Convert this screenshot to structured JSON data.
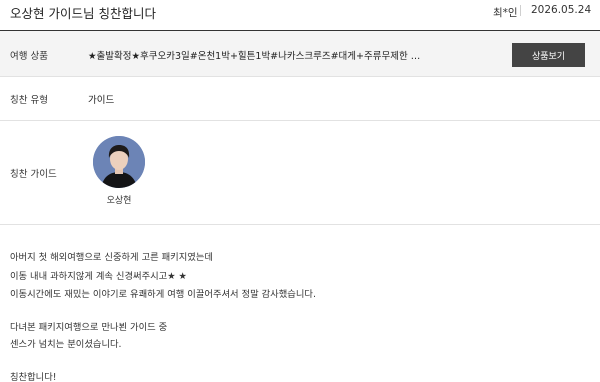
{
  "header": {
    "title": "오상현 가이드님 칭찬합니다",
    "author": "최*인",
    "date": "2026.05.24"
  },
  "info": {
    "product_label": "여행 상품",
    "product_value": "★출발확정★후쿠오카3일#온천1박+힐튼1박#나카스크루즈#대게+주류무제한 #유...",
    "product_button": "상품보기",
    "type_label": "칭찬 유형",
    "type_value": "가이드",
    "guide_label": "칭찬 가이드",
    "guide_name": "오상현"
  },
  "body": {
    "lines": [
      "아버지 첫 해외여행으로 신중하게 고른 패키지였는데",
      "이동 내내 과하지않게 계속 신경써주시고★ ★",
      "이동시간에도 재밌는 이야기로 유쾌하게 여행 이끌어주셔서 정말 감사했습니다.",
      "",
      "다녀본 패키지여행으로 만나뵌 가이드 중",
      "센스가 넘치는 분이셨습니다.",
      "",
      "칭찬합니다!"
    ]
  }
}
